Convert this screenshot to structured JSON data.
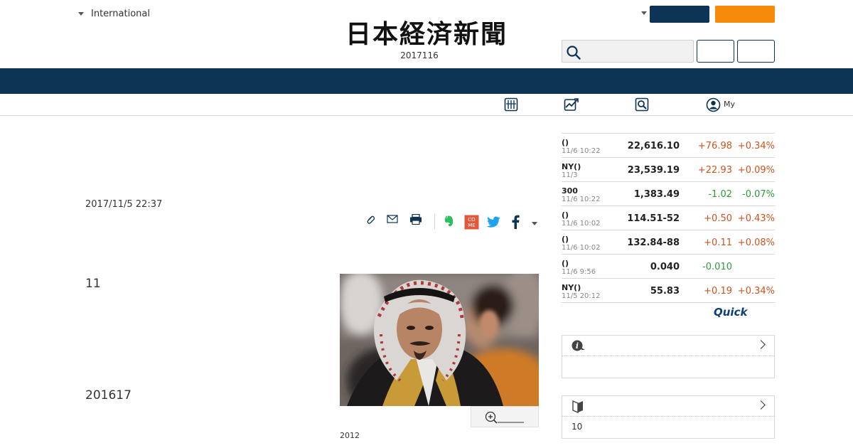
{
  "header": {
    "edition_label": "International",
    "logo_text": "日本経済新聞",
    "date": "2017116",
    "my_label": "My"
  },
  "article": {
    "timestamp": "2017/11/5 22:37",
    "paragraph_1": "11",
    "paragraph_2": "201617",
    "photo_caption": "2012"
  },
  "market": {
    "rows": [
      {
        "name": "()",
        "time": "11/6 10:22",
        "value": "22,616.10",
        "change": "+76.98",
        "pct": "+0.34%",
        "dir": "up"
      },
      {
        "name": "NY()",
        "time": "11/3",
        "value": "23,539.19",
        "change": "+22.93",
        "pct": "+0.09%",
        "dir": "up"
      },
      {
        "name": "300",
        "time": "11/6 10:22",
        "value": "1,383.49",
        "change": "-1.02",
        "pct": "-0.07%",
        "dir": "down"
      },
      {
        "name": "()",
        "time": "11/6 10:02",
        "value": "114.51-52",
        "change": "+0.50",
        "pct": "+0.43%",
        "dir": "up"
      },
      {
        "name": "()",
        "time": "11/6 10:02",
        "value": "132.84-88",
        "change": "+0.11",
        "pct": "+0.08%",
        "dir": "up"
      },
      {
        "name": "()",
        "time": "11/6 9:56",
        "value": "0.040",
        "change": "-0.010",
        "pct": "",
        "dir": "down"
      },
      {
        "name": "NY()",
        "time": "11/5 20:12",
        "value": "55.83",
        "change": "+0.19",
        "pct": "+0.34%",
        "dir": "up"
      }
    ],
    "brand": "Quick"
  },
  "panels": {
    "info_body": "",
    "beginner_body": "10"
  },
  "colors": {
    "navy": "#0d3355",
    "orange": "#f58a0b",
    "up": "#d0521b",
    "down": "#2f9a3c"
  }
}
